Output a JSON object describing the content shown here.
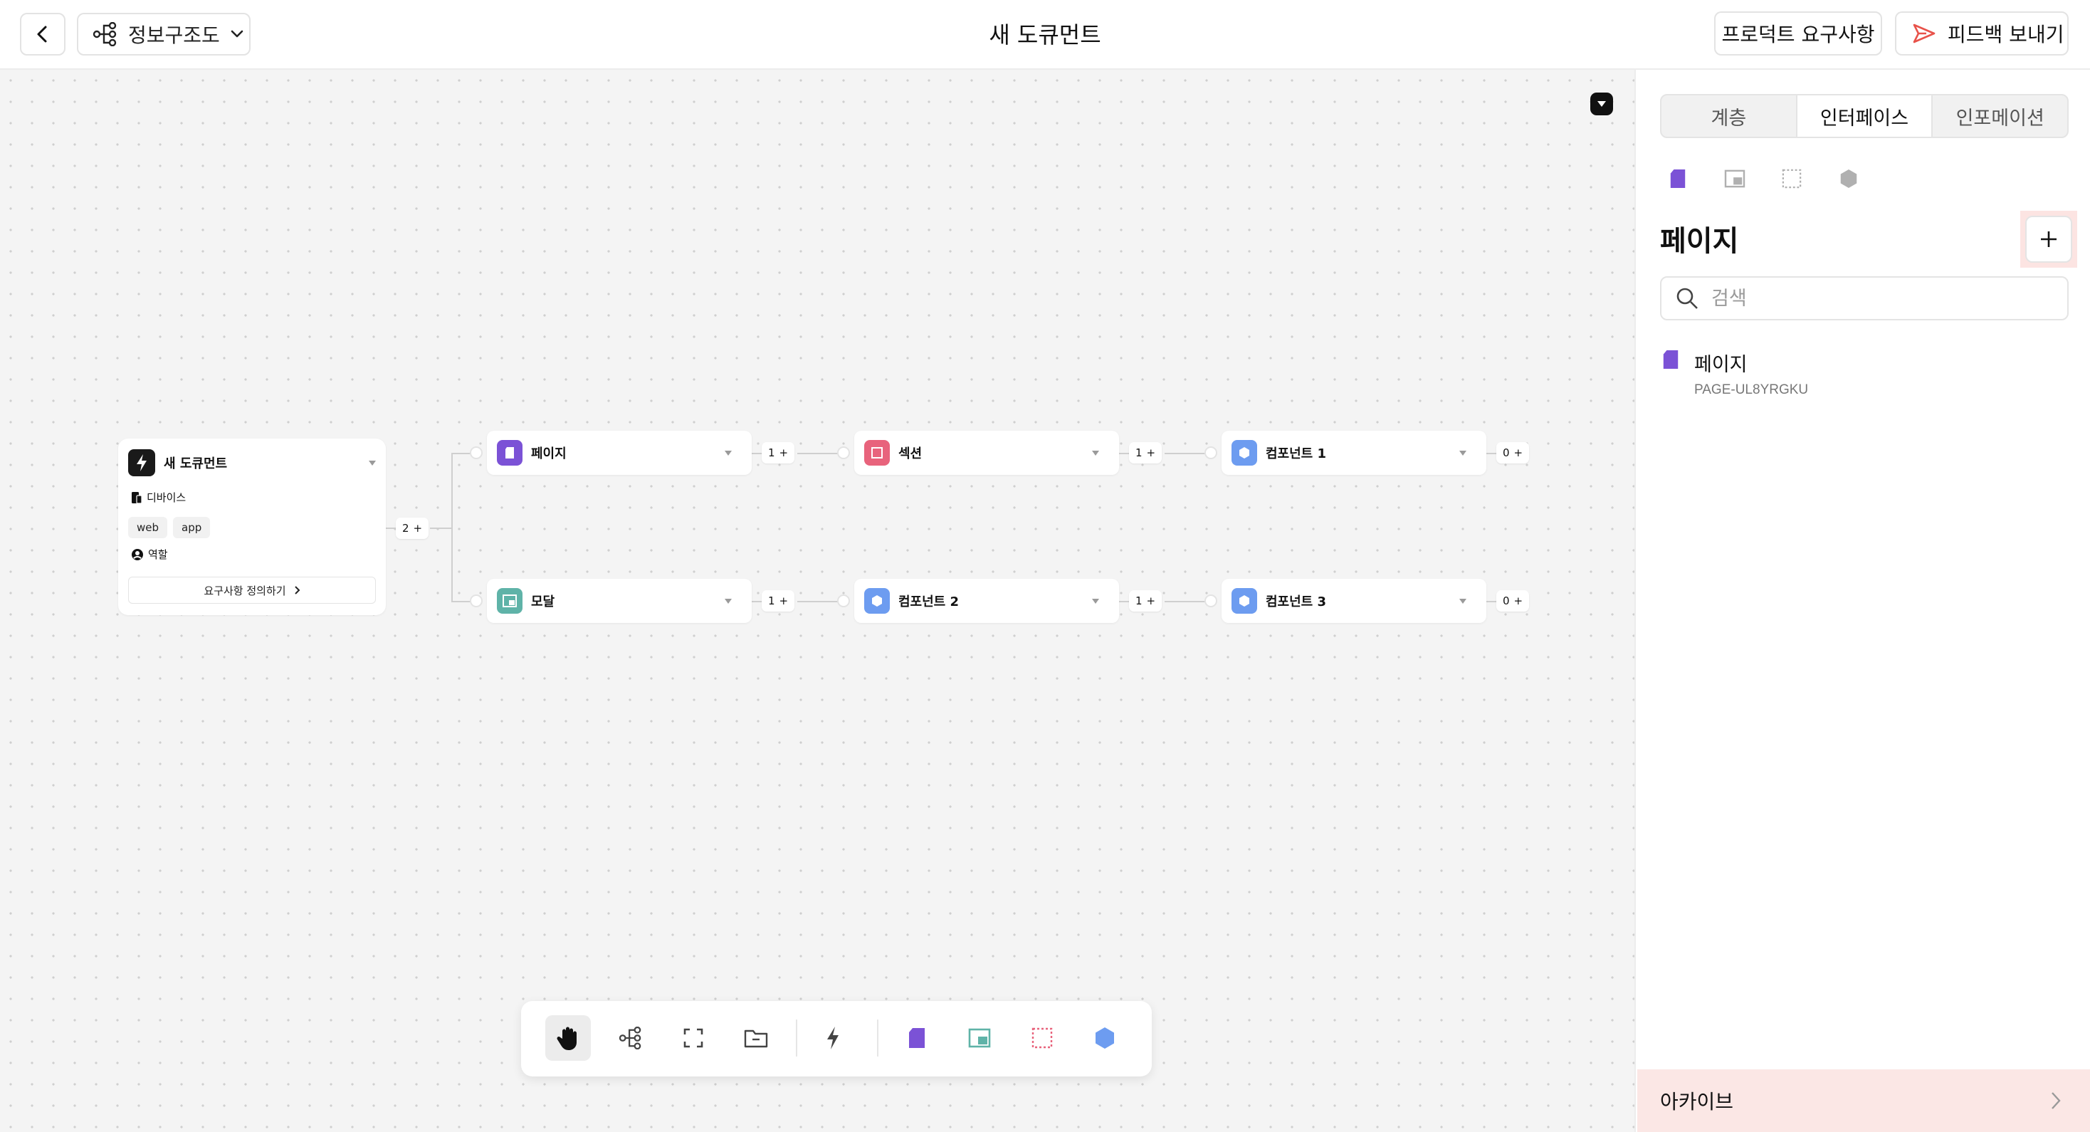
{
  "header": {
    "mode_label": "정보구조도",
    "doc_title": "새 도큐먼트",
    "requirements_label": "프로덕트 요구사항",
    "feedback_label": "피드백 보내기"
  },
  "root_card": {
    "title": "새 도큐먼트",
    "device_label": "디바이스",
    "chips": [
      "web",
      "app"
    ],
    "role_label": "역할",
    "define_button": "요구사항 정의하기",
    "child_count": "2"
  },
  "nodes": {
    "page": {
      "label": "페이지",
      "count": "1"
    },
    "section": {
      "label": "섹션",
      "count": "1"
    },
    "component1": {
      "label": "컴포넌트 1",
      "count": "0"
    },
    "modal": {
      "label": "모달",
      "count": "1"
    },
    "component2": {
      "label": "컴포넌트 2",
      "count": "1"
    },
    "component3": {
      "label": "컴포넌트 3",
      "count": "0"
    }
  },
  "toolbar": {
    "tools": [
      "hand-icon",
      "tree-icon",
      "frame-icon",
      "folder-icon",
      "bolt-icon",
      "page-icon",
      "modal-icon",
      "section-icon",
      "component-icon"
    ],
    "active_tool": "hand-icon"
  },
  "panel": {
    "tabs": [
      "계층",
      "인터페이스",
      "인포메이션"
    ],
    "active_tab": "인터페이스",
    "section_title": "페이지",
    "search_placeholder": "검색",
    "items": [
      {
        "title": "페이지",
        "id": "PAGE-UL8YRGKU"
      }
    ],
    "archive_label": "아카이브"
  },
  "colors": {
    "page": "#7b52d6",
    "modal": "#5fb3a8",
    "section": "#e8637c",
    "component": "#6d9cf0",
    "feedback_accent": "#e8524a",
    "highlight": "#fce4e2"
  }
}
